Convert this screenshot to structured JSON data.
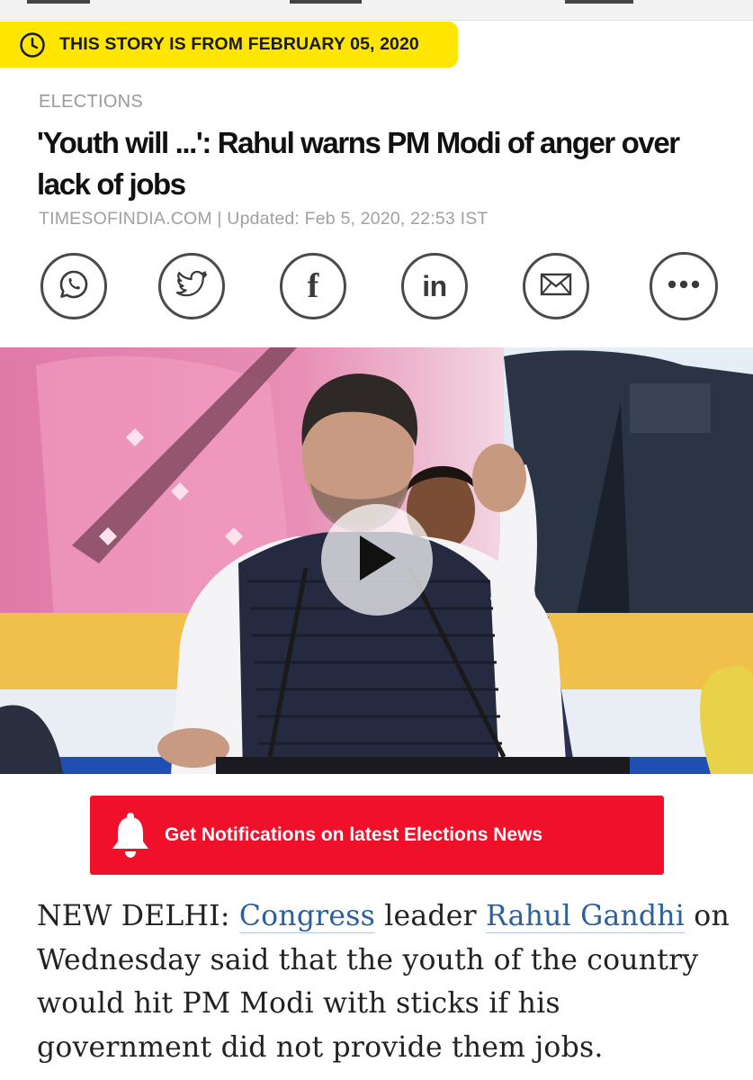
{
  "banner": {
    "icon": "clock-icon",
    "text": "THIS STORY IS FROM FEBRUARY 05, 2020",
    "color": "#fee600"
  },
  "article_header": {
    "section": "ELECTIONS",
    "headline": "'Youth will ...': Rahul warns PM Modi of anger over lack of jobs",
    "meta": "TIMESOFINDIA.COM | Updated: Feb 5, 2020, 22:53 IST"
  },
  "share_buttons": [
    {
      "name": "whatsapp",
      "icon": "whatsapp-icon"
    },
    {
      "name": "twitter",
      "icon": "twitter-icon"
    },
    {
      "name": "facebook",
      "icon": "facebook-icon",
      "label": "f"
    },
    {
      "name": "linkedin",
      "icon": "linkedin-icon",
      "label": "in"
    },
    {
      "name": "email",
      "icon": "mail-icon"
    },
    {
      "name": "more",
      "icon": "more-icon"
    }
  ],
  "video": {
    "play_icon": "play-icon"
  },
  "notification": {
    "icon": "bell-icon",
    "text": "Get Notifications on latest Elections News",
    "color": "#f0102a"
  },
  "body": {
    "dateline": "NEW DELHI:",
    "link1": "Congress",
    "text1": "leader",
    "link2": "Rahul Gandhi",
    "text2": "on Wednesday said that the youth of the country would hit PM Modi with sticks if his government did not provide them jobs.",
    "link_color": "#2a5fa0"
  }
}
